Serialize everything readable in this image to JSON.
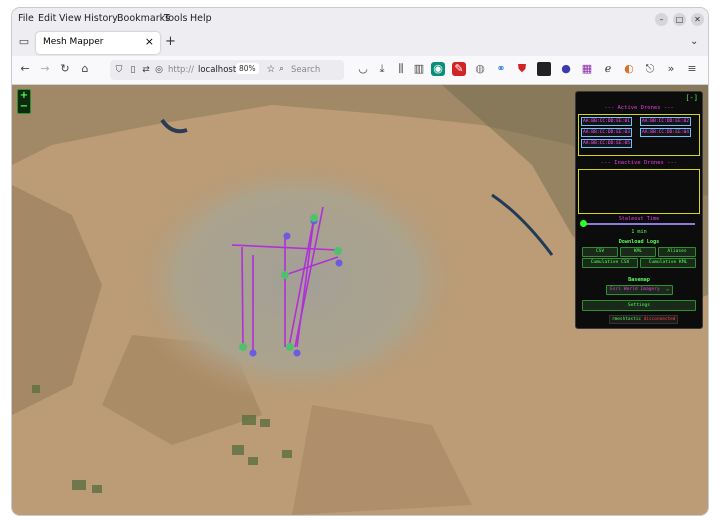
{
  "menu": [
    "File",
    "Edit",
    "View",
    "History",
    "Bookmarks",
    "Tools",
    "Help"
  ],
  "menu_underline": [
    "F",
    "E",
    "V",
    "s",
    "B",
    "T",
    "H"
  ],
  "tab": {
    "title": "Mesh Mapper",
    "close": "×",
    "new": "+"
  },
  "nav": {
    "url_prefix": "http://",
    "url_host": "localhost:",
    "zoom": "80%",
    "search_placeholder": "Search"
  },
  "panel": {
    "collapse": "[-]",
    "active_title": "--- Active Drones ---",
    "active_drones": [
      "AA:BB:CC:DD:EE:01",
      "AA:BB:CC:DD:EE:02",
      "AA:BB:CC:DD:EE:03",
      "AA:BB:CC:DD:EE:04",
      "AA:BB:CC:DD:EE:05"
    ],
    "inactive_title": "--- Inactive Drones ---",
    "staleout_title": "Staleout Time",
    "staleout_value": "1 min",
    "staleout_fraction": 0.0,
    "download_title": "Download Logs",
    "btn_csv": "CSV",
    "btn_kml": "KML",
    "btn_aliases": "Aliases",
    "btn_cum_csv": "Cumulative CSV",
    "btn_cum_kml": "Cumulative KML",
    "basemap_title": "Basemap",
    "basemap_value": "Esri World Imagery",
    "settings": "Settings",
    "status_left": "rmeshtastic",
    "status_right": "disconnected"
  },
  "colors": {
    "accent_green": "#56ff56",
    "accent_magenta": "#e040e0",
    "track": "#b030d8",
    "box": "#d4d424"
  }
}
